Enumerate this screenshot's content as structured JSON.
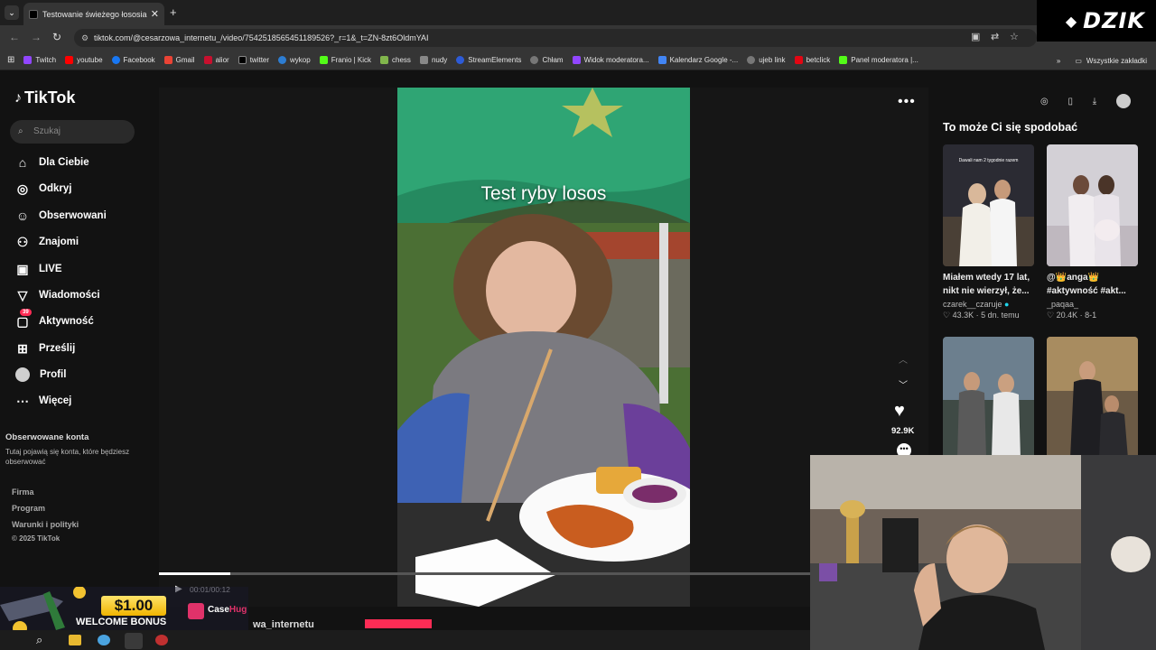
{
  "browser": {
    "tab_title": "Testowanie świeżego łososia z",
    "url": "tiktok.com/@cesarzowa_internetu_/video/7542518565451189526?_r=1&_t=ZN-8zt6OldmYAI",
    "bookmarks": [
      "Twitch",
      "youtube",
      "Facebook",
      "Gmail",
      "alior",
      "twitter",
      "wykop",
      "Franio | Kick",
      "chess",
      "nudy",
      "StreamElements",
      "Chłam",
      "Widok moderatora...",
      "Kalendarz Google -...",
      "ujeb link",
      "betclick",
      "Panel moderatora |..."
    ],
    "all_bookmarks": "Wszystkie zakładki"
  },
  "overlay_brand": "DZIK",
  "tiktok": {
    "logo": "TikTok",
    "search_placeholder": "Szukaj",
    "nav": [
      "Dla Ciebie",
      "Odkryj",
      "Obserwowani",
      "Znajomi",
      "LIVE",
      "Wiadomości",
      "Aktywność",
      "Prześlij",
      "Profil",
      "Więcej"
    ],
    "activity_badge": "39",
    "followed_heading": "Obserwowane konta",
    "followed_text": "Tutaj pojawią się konta, które będziesz obserwować",
    "footer": [
      "Firma",
      "Program",
      "Warunki i polityki",
      "© 2025 TikTok"
    ]
  },
  "video": {
    "caption": "Test ryby losos",
    "likes": "92.9K",
    "time": "00:01/00:12",
    "author": "wa_internetu",
    "progress": 0.11
  },
  "recommend": {
    "heading": "To może Ci się spodobać",
    "cards": [
      {
        "title": "Miałem wtedy 17 lat, nikt nie wierzył, że...",
        "user": "czarek__czaruje",
        "likes": "43.3K",
        "meta": "5 dn. temu",
        "thumb_text": "Dawali nam 2 tygodnie razem"
      },
      {
        "title": "@👑anga👑 #aktywność #akt...",
        "user": "_paqaa_",
        "likes": "20.4K",
        "meta": "8-1",
        "thumb_text": ""
      },
      {
        "title": "",
        "user": "",
        "likes": "",
        "meta": "",
        "thumb_text": ""
      },
      {
        "title": "",
        "user": "",
        "likes": "",
        "meta": "",
        "thumb_text": ""
      }
    ]
  },
  "promo": {
    "amount": "$1.00",
    "text": "WELCOME BONUS",
    "brand_a": "Case",
    "brand_b": "Hug"
  },
  "colors": {
    "accent": "#fe2c55",
    "background": "#121212",
    "verified": "#20d5ec"
  }
}
